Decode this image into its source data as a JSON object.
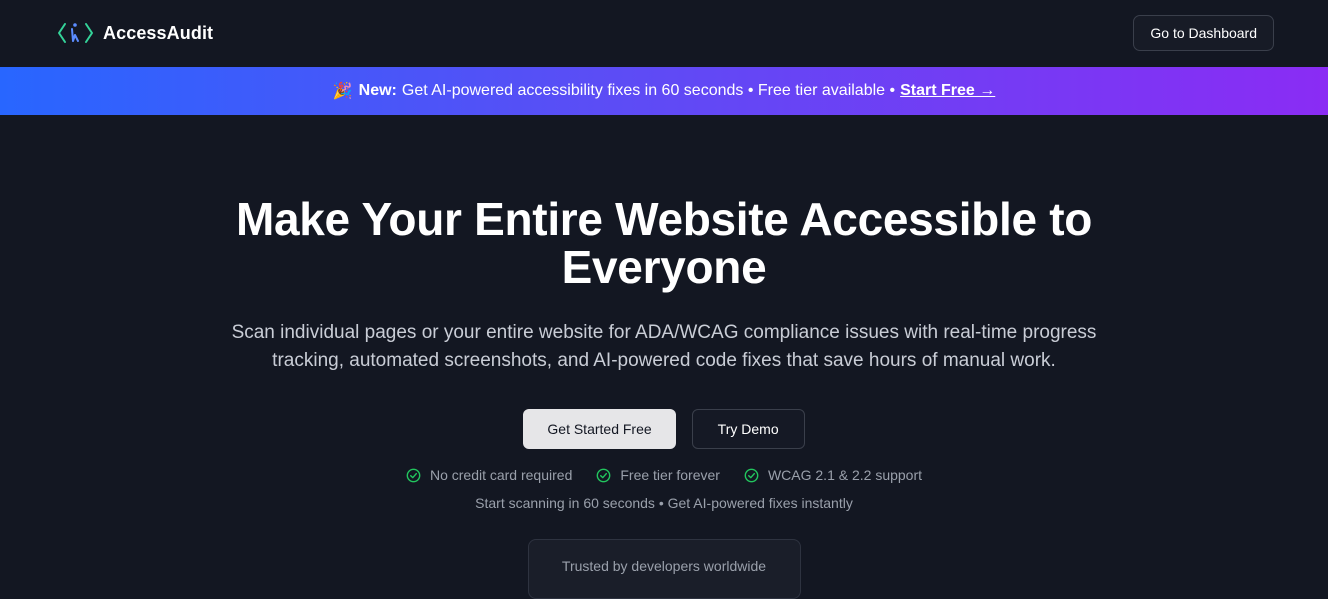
{
  "brand": {
    "name": "AccessAudit",
    "accent": "#34d399",
    "icon": "braces-accessibility-logo-icon"
  },
  "nav": {
    "dashboard_label": "Go to Dashboard"
  },
  "banner": {
    "emoji": "🎉",
    "new_label": "New:",
    "text": "Get AI-powered accessibility fixes in 60 seconds • Free tier available •",
    "link_label": "Start Free →",
    "gradient": [
      "#2866ff",
      "#8a2cf4"
    ]
  },
  "hero": {
    "title": "Make Your Entire Website Accessible to Everyone",
    "subtitle": "Scan individual pages or your entire website for ADA/WCAG compliance issues with real-time progress tracking, automated screenshots, and AI-powered code fixes that save hours of manual work.",
    "primary_cta": "Get Started Free",
    "secondary_cta": "Try Demo",
    "features": [
      {
        "label": "No credit card required",
        "icon": "check-circle-icon"
      },
      {
        "label": "Free tier forever",
        "icon": "check-circle-icon"
      },
      {
        "label": "WCAG 2.1 & 2.2 support",
        "icon": "check-circle-icon"
      }
    ],
    "tagline": "Start scanning in 60 seconds • Get AI-powered fixes instantly",
    "trusted": "Trusted by developers worldwide"
  }
}
